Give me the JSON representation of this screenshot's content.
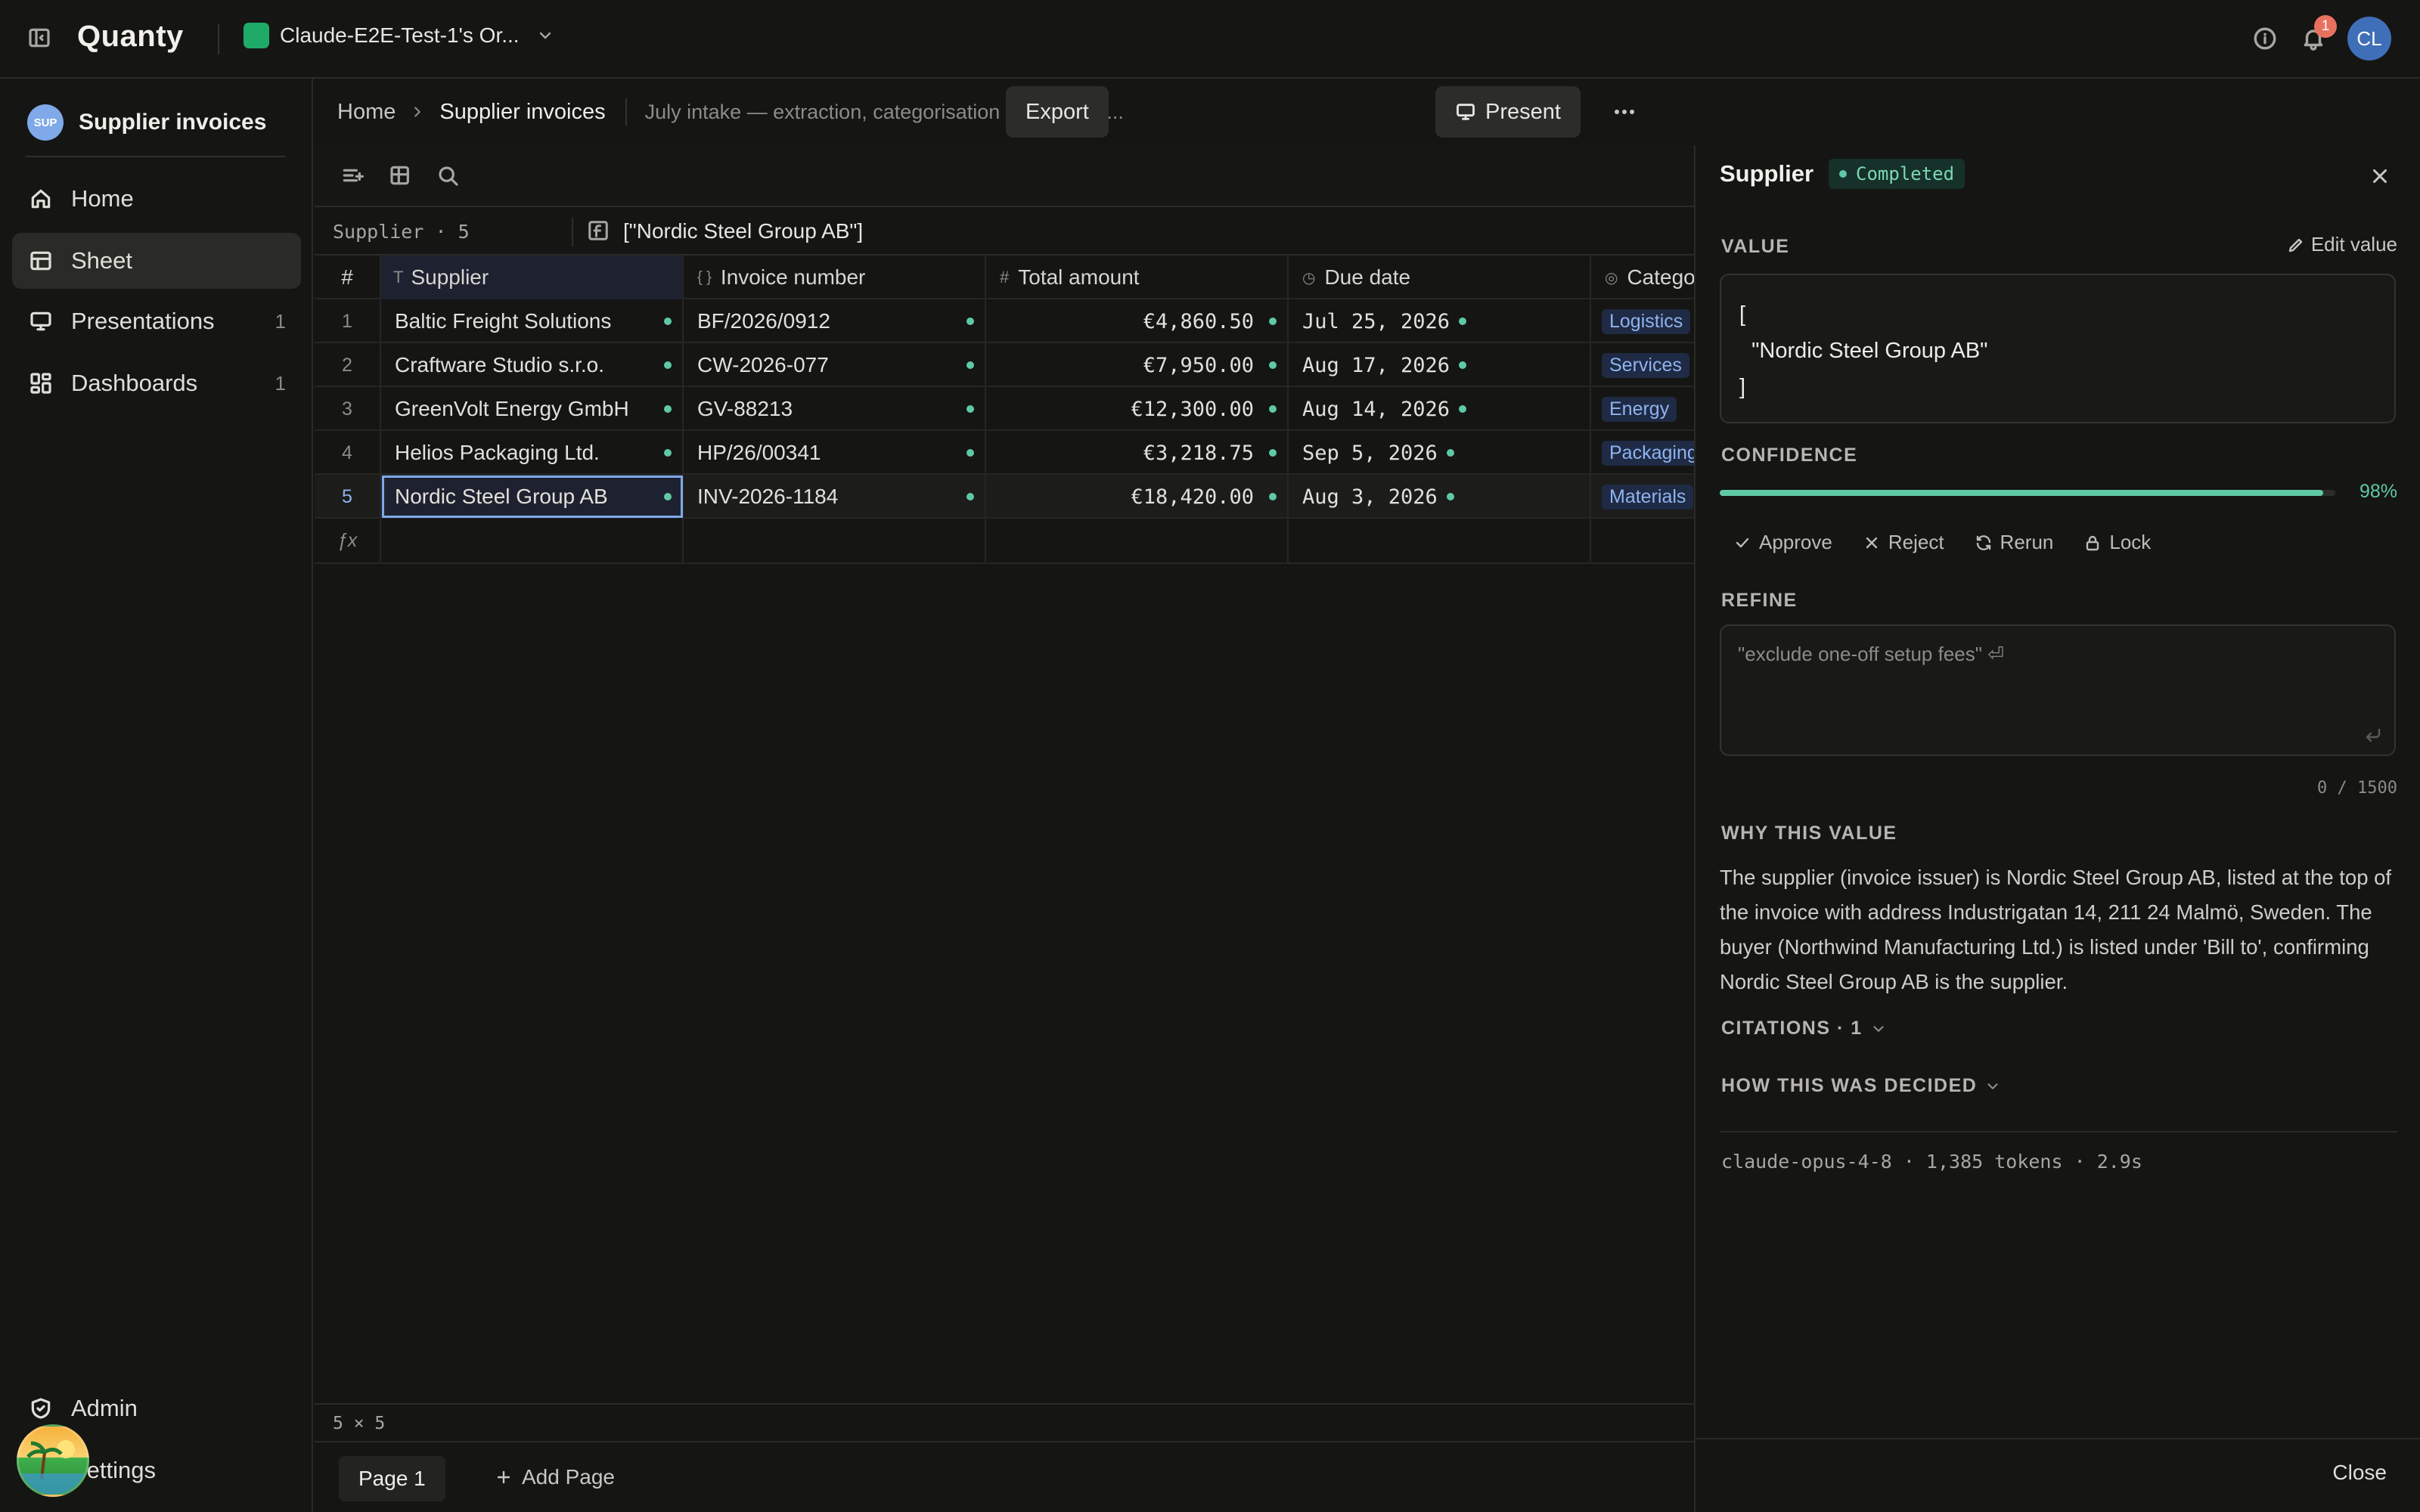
{
  "app": {
    "name": "Quanty",
    "org_name": "Claude-E2E-Test-1's Or...",
    "notification_count": "1",
    "avatar_initials": "CL",
    "accent": "#5fc9a6"
  },
  "sidebar": {
    "workspace_badge": "SUP",
    "workspace_name": "Supplier invoices",
    "items": [
      {
        "label": "Home",
        "icon": "home-icon",
        "count": ""
      },
      {
        "label": "Sheet",
        "icon": "table-icon",
        "count": ""
      },
      {
        "label": "Presentations",
        "icon": "presentation-icon",
        "count": "1"
      },
      {
        "label": "Dashboards",
        "icon": "dashboard-icon",
        "count": "1"
      }
    ],
    "admin_label": "Admin",
    "settings_label": "Settings"
  },
  "header": {
    "breadcrumb": [
      "Home",
      "Supplier invoices"
    ],
    "description": "July intake — extraction, categorisation and payme...",
    "export_label": "Export",
    "present_label": "Present"
  },
  "sheet": {
    "cell_ref": "Supplier · 5",
    "formula_value": "[\"Nordic Steel Group AB\"]",
    "columns": [
      {
        "label": "#",
        "type_icon": ""
      },
      {
        "label": "Supplier",
        "type_icon": "T"
      },
      {
        "label": "Invoice number",
        "type_icon": "{ }"
      },
      {
        "label": "Total amount",
        "type_icon": "#"
      },
      {
        "label": "Due date",
        "type_icon": "◷"
      },
      {
        "label": "Catego",
        "type_icon": "◎"
      }
    ],
    "rows": [
      {
        "n": "1",
        "supplier": "Baltic Freight Solutions",
        "invoice": "BF/2026/0912",
        "amount": "€4,860.50",
        "due": "Jul 25, 2026",
        "category": "Logistics"
      },
      {
        "n": "2",
        "supplier": "Craftware Studio s.r.o.",
        "invoice": "CW-2026-077",
        "amount": "€7,950.00",
        "due": "Aug 17, 2026",
        "category": "Services"
      },
      {
        "n": "3",
        "supplier": "GreenVolt Energy GmbH",
        "invoice": "GV-88213",
        "amount": "€12,300.00",
        "due": "Aug 14, 2026",
        "category": "Energy"
      },
      {
        "n": "4",
        "supplier": "Helios Packaging Ltd.",
        "invoice": "HP/26/00341",
        "amount": "€3,218.75",
        "due": "Sep 5, 2026",
        "category": "Packaging"
      },
      {
        "n": "5",
        "supplier": "Nordic Steel Group AB",
        "invoice": "INV-2026-1184",
        "amount": "€18,420.00",
        "due": "Aug 3, 2026",
        "category": "Materials"
      }
    ],
    "fx_label": "ƒx",
    "dimensions": "5 × 5"
  },
  "pages": {
    "current": "Page 1",
    "add_label": "Add Page"
  },
  "panel": {
    "title": "Supplier",
    "status": "Completed",
    "value_label": "VALUE",
    "edit_label": "Edit value",
    "value_lines": [
      "[",
      "  \"Nordic Steel Group AB\"",
      "]"
    ],
    "confidence_label": "CONFIDENCE",
    "confidence": 0.98,
    "confidence_text": "98%",
    "actions": [
      "Approve",
      "Reject",
      "Rerun",
      "Lock"
    ],
    "refine_label": "REFINE",
    "refine_placeholder": "\"exclude one-off setup fees\" ⏎",
    "char_count": "0 / 1500",
    "why_label": "WHY THIS VALUE",
    "why_text": "The supplier (invoice issuer) is Nordic Steel Group AB, listed at the top of the invoice with address Industrigatan 14, 211 24 Malmö, Sweden. The buyer (Northwind Manufacturing Ltd.) is listed under 'Bill to', confirming Nordic Steel Group AB is the supplier.",
    "citations_label": "CITATIONS · 1",
    "decided_label": "HOW THIS WAS DECIDED",
    "meta": "claude-opus-4-8 · 1,385 tokens · 2.9s",
    "close_label": "Close"
  }
}
